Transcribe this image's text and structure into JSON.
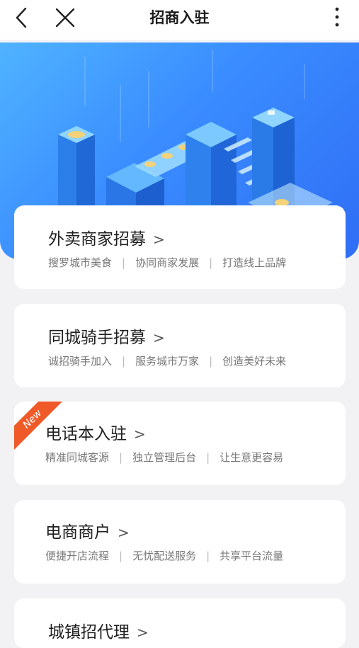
{
  "header": {
    "title": "招商入驻"
  },
  "cards": [
    {
      "title": "外卖商家招募",
      "tags": [
        "搜罗城市美食",
        "协同商家发展",
        "打造线上品牌"
      ]
    },
    {
      "title": "同城骑手招募",
      "tags": [
        "诚招骑手加入",
        "服务城市万家",
        "创造美好未来"
      ]
    },
    {
      "title": "电话本入驻",
      "badge": "New",
      "tags": [
        "精准同城客源",
        "独立管理后台",
        "让生意更容易"
      ]
    },
    {
      "title": "电商商户",
      "tags": [
        "便捷开店流程",
        "无忧配送服务",
        "共享平台流量"
      ]
    },
    {
      "title": "城镇招代理",
      "tags": []
    }
  ],
  "chevron": ">",
  "separator": "|",
  "colors": {
    "banner": "#3a8cff",
    "badge": "#f05a28",
    "background": "#f2f2f4"
  },
  "icons": {
    "back": "back-icon",
    "close": "close-icon",
    "more": "more-vertical-icon"
  }
}
